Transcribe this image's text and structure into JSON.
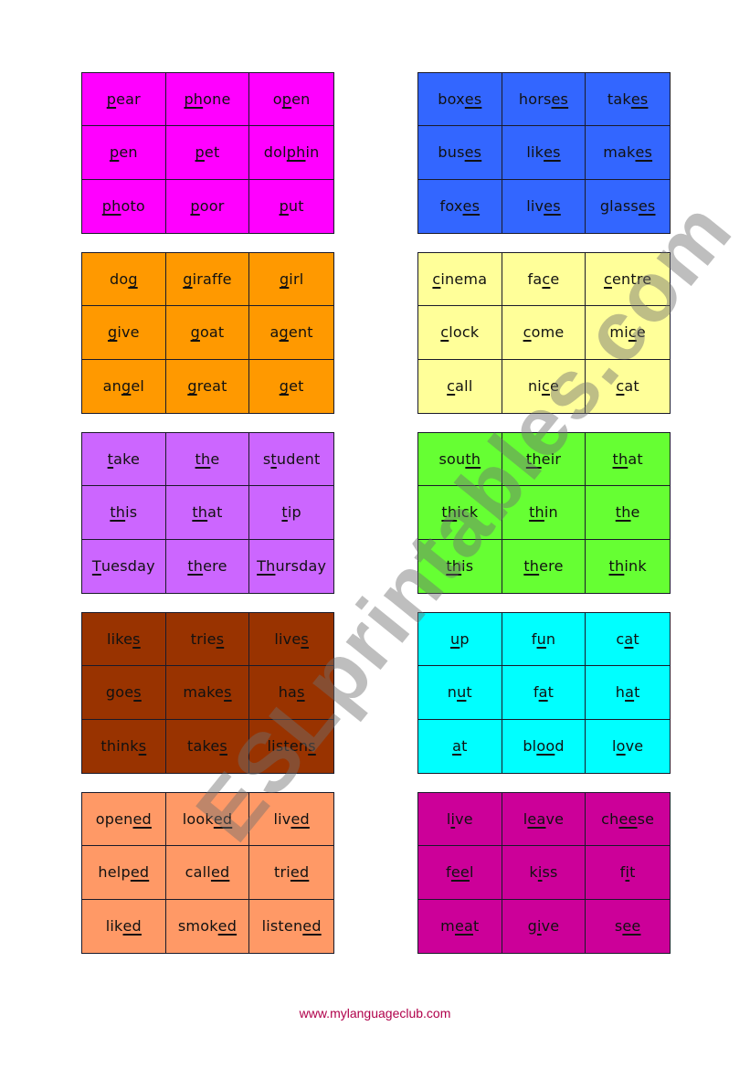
{
  "grids": [
    {
      "id": "p-sounds",
      "color": "#ff00ff",
      "cells": [
        {
          "pre": "",
          "ul": "p",
          "post": "ear"
        },
        {
          "pre": "",
          "ul": "ph",
          "post": "one"
        },
        {
          "pre": "o",
          "ul": "p",
          "post": "en"
        },
        {
          "pre": "",
          "ul": "p",
          "post": "en"
        },
        {
          "pre": "",
          "ul": "p",
          "post": "et"
        },
        {
          "pre": "dol",
          "ul": "ph",
          "post": "in"
        },
        {
          "pre": "",
          "ul": "ph",
          "post": "oto"
        },
        {
          "pre": "",
          "ul": "p",
          "post": "oor"
        },
        {
          "pre": "",
          "ul": "p",
          "post": "ut"
        }
      ]
    },
    {
      "id": "es-endings",
      "color": "#3366ff",
      "cells": [
        {
          "pre": "box",
          "ul": "es",
          "post": ""
        },
        {
          "pre": "hors",
          "ul": "es",
          "post": ""
        },
        {
          "pre": "tak",
          "ul": "es",
          "post": ""
        },
        {
          "pre": "bus",
          "ul": "es",
          "post": ""
        },
        {
          "pre": "lik",
          "ul": "es",
          "post": ""
        },
        {
          "pre": "mak",
          "ul": "es",
          "post": ""
        },
        {
          "pre": "fox",
          "ul": "es",
          "post": ""
        },
        {
          "pre": "liv",
          "ul": "es",
          "post": ""
        },
        {
          "pre": "glass",
          "ul": "es",
          "post": ""
        }
      ]
    },
    {
      "id": "g-sounds",
      "color": "#ff9900",
      "cells": [
        {
          "pre": "do",
          "ul": "g",
          "post": ""
        },
        {
          "pre": "",
          "ul": "g",
          "post": "iraffe"
        },
        {
          "pre": "",
          "ul": "g",
          "post": "irl"
        },
        {
          "pre": "",
          "ul": "g",
          "post": "ive"
        },
        {
          "pre": "",
          "ul": "g",
          "post": "oat"
        },
        {
          "pre": "a",
          "ul": "g",
          "post": "ent"
        },
        {
          "pre": "an",
          "ul": "g",
          "post": "el"
        },
        {
          "pre": "",
          "ul": "g",
          "post": "reat"
        },
        {
          "pre": "",
          "ul": "g",
          "post": "et"
        }
      ]
    },
    {
      "id": "c-sounds",
      "color": "#ffff99",
      "cells": [
        {
          "pre": "",
          "ul": "c",
          "post": "inema"
        },
        {
          "pre": "fa",
          "ul": "c",
          "post": "e"
        },
        {
          "pre": "",
          "ul": "c",
          "post": "entre"
        },
        {
          "pre": "",
          "ul": "c",
          "post": "lock"
        },
        {
          "pre": "",
          "ul": "c",
          "post": "ome"
        },
        {
          "pre": "mi",
          "ul": "c",
          "post": "e"
        },
        {
          "pre": "",
          "ul": "c",
          "post": "all"
        },
        {
          "pre": "ni",
          "ul": "c",
          "post": "e"
        },
        {
          "pre": "",
          "ul": "c",
          "post": "at"
        }
      ]
    },
    {
      "id": "t-th-sounds",
      "color": "#cc66ff",
      "cells": [
        {
          "pre": "",
          "ul": "t",
          "post": "ake"
        },
        {
          "pre": "",
          "ul": "th",
          "post": "e"
        },
        {
          "pre": "s",
          "ul": "t",
          "post": "udent"
        },
        {
          "pre": "",
          "ul": "th",
          "post": "is"
        },
        {
          "pre": "",
          "ul": "th",
          "post": "at"
        },
        {
          "pre": "",
          "ul": "t",
          "post": "ip"
        },
        {
          "pre": "",
          "ul": "T",
          "post": "uesday"
        },
        {
          "pre": "",
          "ul": "th",
          "post": "ere"
        },
        {
          "pre": "",
          "ul": "Th",
          "post": "ursday"
        }
      ]
    },
    {
      "id": "th-sounds",
      "color": "#66ff33",
      "cells": [
        {
          "pre": "sou",
          "ul": "th",
          "post": ""
        },
        {
          "pre": "",
          "ul": "th",
          "post": "eir"
        },
        {
          "pre": "",
          "ul": "th",
          "post": "at"
        },
        {
          "pre": "",
          "ul": "th",
          "post": "ick"
        },
        {
          "pre": "",
          "ul": "th",
          "post": "in"
        },
        {
          "pre": "",
          "ul": "th",
          "post": "e"
        },
        {
          "pre": "",
          "ul": "th",
          "post": "is"
        },
        {
          "pre": "",
          "ul": "th",
          "post": "ere"
        },
        {
          "pre": "",
          "ul": "th",
          "post": "ink"
        }
      ]
    },
    {
      "id": "s-endings",
      "color": "#993300",
      "cells": [
        {
          "pre": "like",
          "ul": "s",
          "post": ""
        },
        {
          "pre": "trie",
          "ul": "s",
          "post": ""
        },
        {
          "pre": "live",
          "ul": "s",
          "post": ""
        },
        {
          "pre": "goe",
          "ul": "s",
          "post": ""
        },
        {
          "pre": "make",
          "ul": "s",
          "post": ""
        },
        {
          "pre": "ha",
          "ul": "s",
          "post": ""
        },
        {
          "pre": "think",
          "ul": "s",
          "post": ""
        },
        {
          "pre": "take",
          "ul": "s",
          "post": ""
        },
        {
          "pre": "listen",
          "ul": "s",
          "post": ""
        }
      ]
    },
    {
      "id": "short-vowels",
      "color": "#00ffff",
      "cells": [
        {
          "pre": "",
          "ul": "u",
          "post": "p"
        },
        {
          "pre": "f",
          "ul": "u",
          "post": "n"
        },
        {
          "pre": "c",
          "ul": "a",
          "post": "t"
        },
        {
          "pre": "n",
          "ul": "u",
          "post": "t"
        },
        {
          "pre": "f",
          "ul": "a",
          "post": "t"
        },
        {
          "pre": "h",
          "ul": "a",
          "post": "t"
        },
        {
          "pre": "",
          "ul": "a",
          "post": "t"
        },
        {
          "pre": "bl",
          "ul": "oo",
          "post": "d"
        },
        {
          "pre": "l",
          "ul": "o",
          "post": "ve"
        }
      ]
    },
    {
      "id": "ed-endings",
      "color": "#ff9966",
      "cells": [
        {
          "pre": "open",
          "ul": "ed",
          "post": ""
        },
        {
          "pre": "look",
          "ul": "ed",
          "post": ""
        },
        {
          "pre": "liv",
          "ul": "ed",
          "post": ""
        },
        {
          "pre": "help",
          "ul": "ed",
          "post": ""
        },
        {
          "pre": "call",
          "ul": "ed",
          "post": ""
        },
        {
          "pre": "tri",
          "ul": "ed",
          "post": ""
        },
        {
          "pre": "lik",
          "ul": "ed",
          "post": ""
        },
        {
          "pre": "smok",
          "ul": "ed",
          "post": ""
        },
        {
          "pre": "listen",
          "ul": "ed",
          "post": ""
        }
      ]
    },
    {
      "id": "i-ee-vowels",
      "color": "#cc0099",
      "cells": [
        {
          "pre": "l",
          "ul": "i",
          "post": "ve"
        },
        {
          "pre": "l",
          "ul": "ea",
          "post": "ve"
        },
        {
          "pre": "ch",
          "ul": "ee",
          "post": "se"
        },
        {
          "pre": "f",
          "ul": "ee",
          "post": "l"
        },
        {
          "pre": "k",
          "ul": "i",
          "post": "ss"
        },
        {
          "pre": "f",
          "ul": "i",
          "post": "t"
        },
        {
          "pre": "m",
          "ul": "ea",
          "post": "t"
        },
        {
          "pre": "g",
          "ul": "i",
          "post": "ve"
        },
        {
          "pre": "s",
          "ul": "ee",
          "post": ""
        }
      ]
    }
  ],
  "watermark": "ESLprintables.com",
  "footer": "www.mylanguageclub.com"
}
